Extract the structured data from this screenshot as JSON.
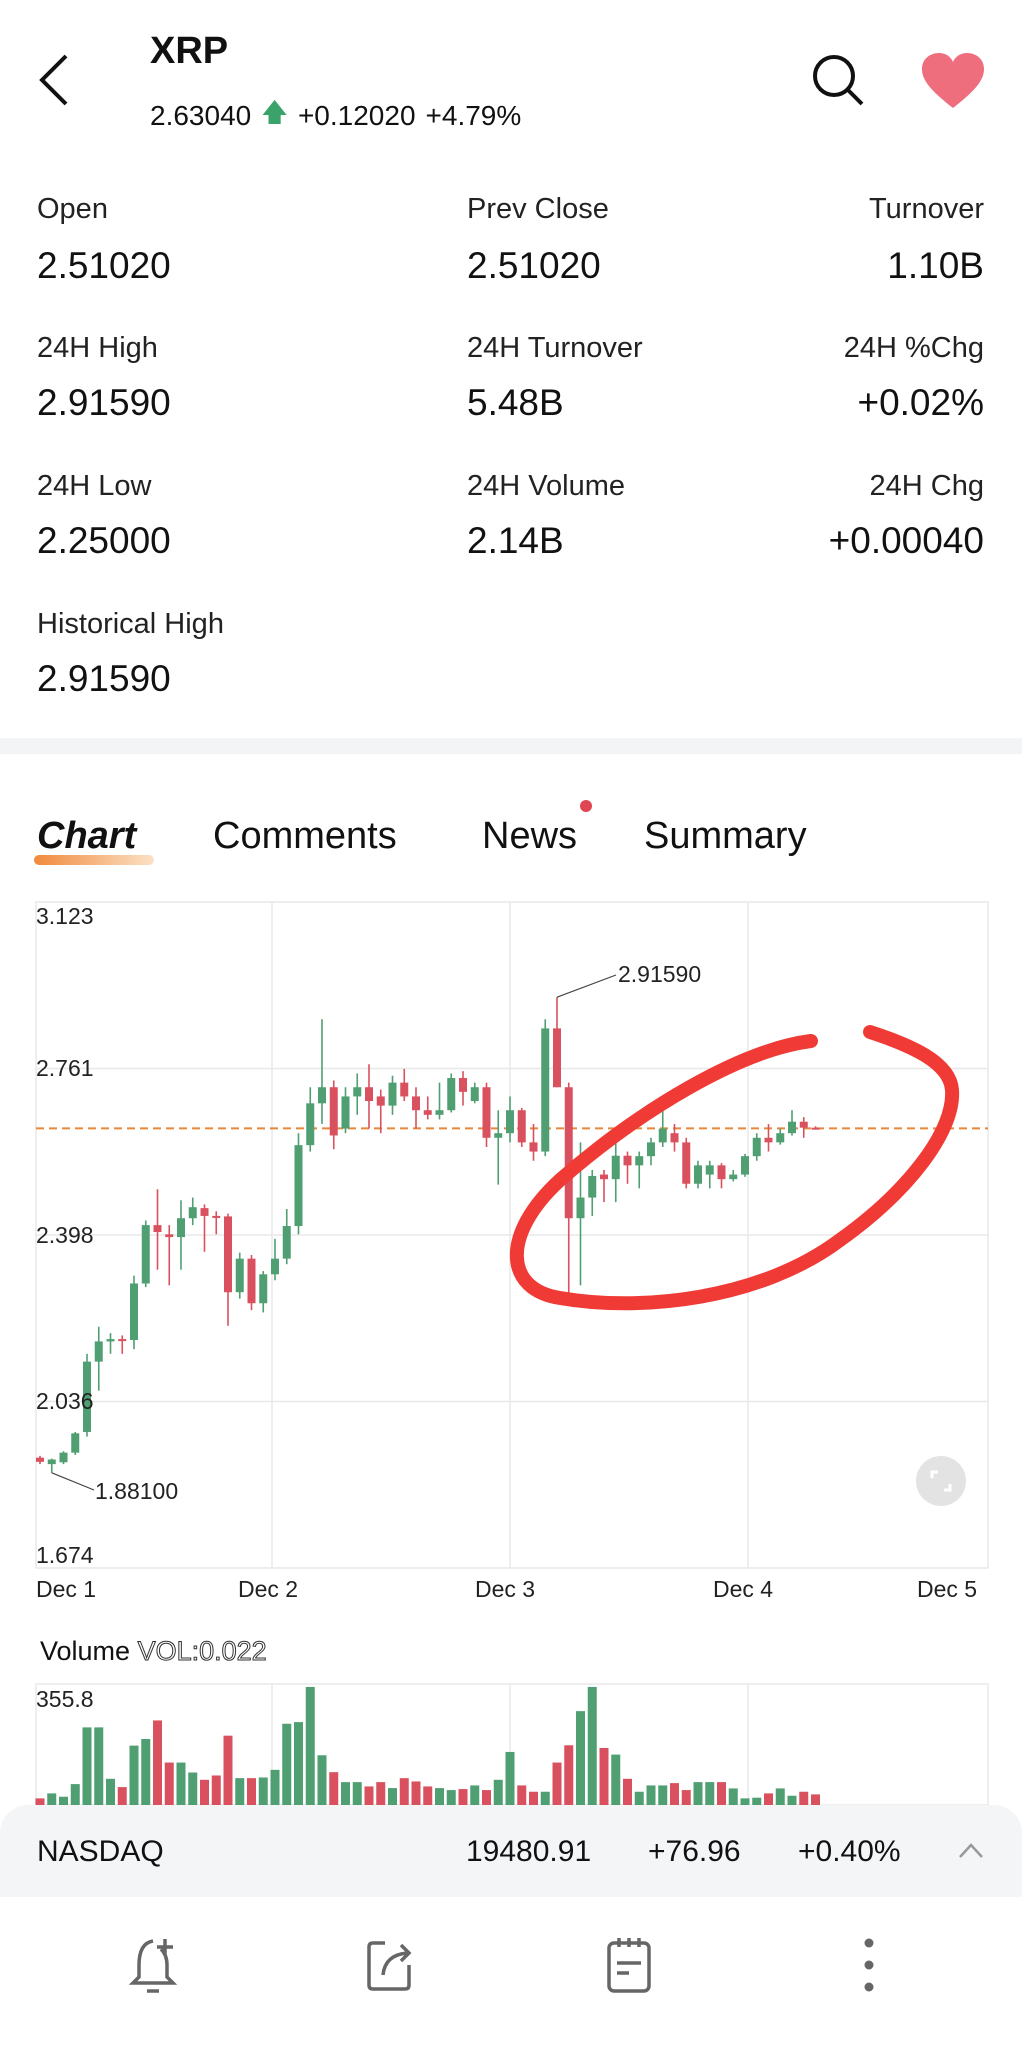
{
  "header": {
    "title": "XRP",
    "price": "2.63040",
    "change": "+0.12020",
    "change_pct": "+4.79%",
    "icons": [
      "back-arrow-icon",
      "search-icon",
      "heart-icon"
    ],
    "favorite_color": "#ee6e7e"
  },
  "stats": [
    {
      "label": "Open",
      "value": "2.51020"
    },
    {
      "label": "Prev Close",
      "value": "2.51020"
    },
    {
      "label": "Turnover",
      "value": "1.10B"
    },
    {
      "label": "24H High",
      "value": "2.91590"
    },
    {
      "label": "24H Turnover",
      "value": "5.48B"
    },
    {
      "label": "24H %Chg",
      "value": "+0.02%"
    },
    {
      "label": "24H Low",
      "value": "2.25000"
    },
    {
      "label": "24H Volume",
      "value": "2.14B"
    },
    {
      "label": "24H Chg",
      "value": "+0.00040"
    },
    {
      "label": "Historical High",
      "value": "2.91590"
    }
  ],
  "tabs": [
    {
      "label": "Chart",
      "active": true
    },
    {
      "label": "Comments"
    },
    {
      "label": "News",
      "badge": true
    },
    {
      "label": "Summary"
    }
  ],
  "colors": {
    "up": "#4f9f72",
    "down": "#d9515e",
    "last_price_line": "#e8883a",
    "annotation": "#f03a35"
  },
  "chart_data": [
    {
      "type": "candlestick",
      "x_ticks": [
        "Dec 1",
        "Dec 2",
        "Dec 3",
        "Dec 4",
        "Dec 5"
      ],
      "y_ticks": [
        "3.123",
        "2.761",
        "2.398",
        "2.036",
        "1.674"
      ],
      "ylim": [
        1.674,
        3.123
      ],
      "grid": true,
      "last_price": 2.6304,
      "max_label": "2.91590",
      "min_label": "1.88100",
      "ohlc": [
        [
          1.914,
          1.918,
          1.9,
          1.905
        ],
        [
          1.9,
          1.912,
          1.881,
          1.91
        ],
        [
          1.904,
          1.928,
          1.9,
          1.925
        ],
        [
          1.925,
          1.97,
          1.92,
          1.967
        ],
        [
          1.97,
          2.14,
          1.96,
          2.123
        ],
        [
          2.123,
          2.199,
          2.06,
          2.167
        ],
        [
          2.167,
          2.185,
          2.14,
          2.172
        ],
        [
          2.172,
          2.18,
          2.14,
          2.168
        ],
        [
          2.17,
          2.31,
          2.15,
          2.293
        ],
        [
          2.293,
          2.43,
          2.285,
          2.42
        ],
        [
          2.42,
          2.498,
          2.323,
          2.405
        ],
        [
          2.4,
          2.42,
          2.289,
          2.394
        ],
        [
          2.394,
          2.474,
          2.323,
          2.435
        ],
        [
          2.435,
          2.48,
          2.42,
          2.459
        ],
        [
          2.457,
          2.465,
          2.362,
          2.44
        ],
        [
          2.44,
          2.45,
          2.4,
          2.439
        ],
        [
          2.439,
          2.445,
          2.201,
          2.274
        ],
        [
          2.274,
          2.36,
          2.26,
          2.347
        ],
        [
          2.347,
          2.355,
          2.235,
          2.25
        ],
        [
          2.25,
          2.32,
          2.23,
          2.313
        ],
        [
          2.313,
          2.39,
          2.3,
          2.347
        ],
        [
          2.347,
          2.455,
          2.335,
          2.418
        ],
        [
          2.418,
          2.62,
          2.4,
          2.594
        ],
        [
          2.594,
          2.72,
          2.58,
          2.685
        ],
        [
          2.685,
          2.868,
          2.64,
          2.72
        ],
        [
          2.72,
          2.735,
          2.585,
          2.615
        ],
        [
          2.63,
          2.72,
          2.62,
          2.7
        ],
        [
          2.7,
          2.75,
          2.66,
          2.72
        ],
        [
          2.72,
          2.77,
          2.63,
          2.69
        ],
        [
          2.7,
          2.715,
          2.62,
          2.68
        ],
        [
          2.68,
          2.745,
          2.66,
          2.73
        ],
        [
          2.73,
          2.76,
          2.69,
          2.7
        ],
        [
          2.7,
          2.72,
          2.63,
          2.67
        ],
        [
          2.67,
          2.7,
          2.65,
          2.66
        ],
        [
          2.66,
          2.73,
          2.65,
          2.67
        ],
        [
          2.67,
          2.75,
          2.665,
          2.74
        ],
        [
          2.74,
          2.755,
          2.68,
          2.71
        ],
        [
          2.69,
          2.73,
          2.685,
          2.72
        ],
        [
          2.72,
          2.73,
          2.59,
          2.61
        ],
        [
          2.61,
          2.67,
          2.508,
          2.62
        ],
        [
          2.62,
          2.7,
          2.6,
          2.67
        ],
        [
          2.67,
          2.675,
          2.59,
          2.6
        ],
        [
          2.6,
          2.64,
          2.56,
          2.58
        ],
        [
          2.58,
          2.868,
          2.57,
          2.848
        ],
        [
          2.848,
          2.9159,
          2.72,
          2.72
        ],
        [
          2.72,
          2.73,
          2.254,
          2.435
        ],
        [
          2.435,
          2.6,
          2.289,
          2.48
        ],
        [
          2.48,
          2.54,
          2.44,
          2.527
        ],
        [
          2.53,
          2.54,
          2.47,
          2.52
        ],
        [
          2.52,
          2.6,
          2.47,
          2.571
        ],
        [
          2.571,
          2.58,
          2.51,
          2.55
        ],
        [
          2.55,
          2.58,
          2.5,
          2.57
        ],
        [
          2.57,
          2.61,
          2.55,
          2.6
        ],
        [
          2.6,
          2.67,
          2.59,
          2.63
        ],
        [
          2.62,
          2.64,
          2.58,
          2.6
        ],
        [
          2.6,
          2.61,
          2.5,
          2.51
        ],
        [
          2.51,
          2.56,
          2.5,
          2.55
        ],
        [
          2.53,
          2.56,
          2.5,
          2.55
        ],
        [
          2.55,
          2.555,
          2.5,
          2.52
        ],
        [
          2.52,
          2.54,
          2.515,
          2.53
        ],
        [
          2.53,
          2.575,
          2.525,
          2.57
        ],
        [
          2.57,
          2.62,
          2.56,
          2.61
        ],
        [
          2.61,
          2.64,
          2.58,
          2.6
        ],
        [
          2.6,
          2.63,
          2.595,
          2.62
        ],
        [
          2.62,
          2.67,
          2.615,
          2.645
        ],
        [
          2.645,
          2.655,
          2.61,
          2.632
        ],
        [
          2.632,
          2.635,
          2.628,
          2.63
        ]
      ]
    },
    {
      "type": "bar",
      "title": "Volume",
      "subtitle": "VOL:0.022",
      "y_max_label": "355.8",
      "ylim": [
        0,
        355.8
      ],
      "values": [
        20,
        35,
        25,
        63,
        234,
        234,
        79,
        54,
        179,
        199,
        255,
        128,
        128,
        98,
        76,
        89,
        209,
        81,
        81,
        83,
        106,
        245,
        250,
        356,
        150,
        99,
        69,
        69,
        56,
        69,
        51,
        81,
        71,
        56,
        51,
        45,
        48,
        59,
        45,
        76,
        160,
        59,
        40,
        40,
        128,
        180,
        283,
        356,
        172,
        152,
        79,
        40,
        59,
        59,
        66,
        45,
        69,
        69,
        69,
        50,
        20,
        22,
        35,
        50,
        28,
        40,
        32
      ]
    }
  ],
  "ticker": {
    "name": "NASDAQ",
    "value": "19480.91",
    "change": "+76.96",
    "change_pct": "+0.40%"
  },
  "bottom_nav": [
    "bell-plus-icon",
    "share-icon",
    "notes-icon",
    "more-vertical-icon"
  ]
}
